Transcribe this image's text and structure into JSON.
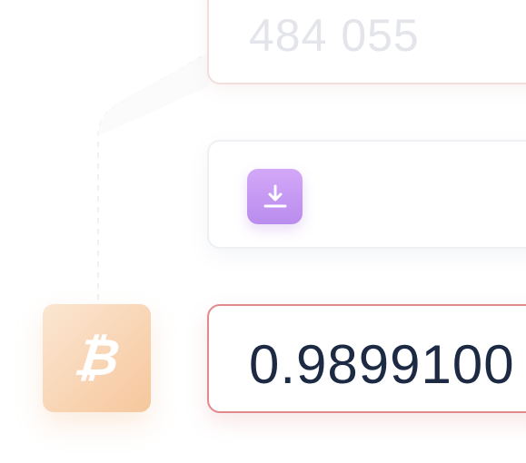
{
  "fields": {
    "top_value": "484 055",
    "bottom_value": "0.9899100"
  },
  "icons": {
    "download": "download-icon",
    "bitcoin": "bitcoin-icon"
  },
  "colors": {
    "bitcoin_tile": "#f6c79c",
    "download_button": "#c39af2",
    "active_border": "#e08a8d",
    "value_text": "#1d2a44"
  }
}
